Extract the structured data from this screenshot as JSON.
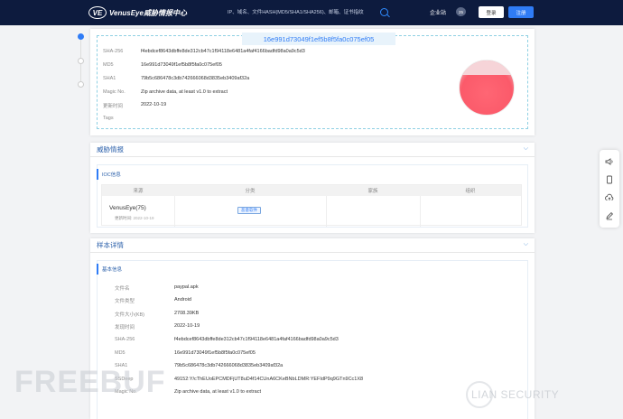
{
  "header": {
    "logo_mark": "VE",
    "logo_text": "VenusEye威胁情报中心",
    "search_placeholder": "IP、域名、文件HASH(MD5/SHA1/SHA256)、邮箱、证书指纹",
    "enterprise_label": "企业站",
    "enterprise_badge": "25",
    "login_label": "登录",
    "register_label": "注册"
  },
  "summary": {
    "title": "16e991d73049f1ef5b8f5fa0c075ef05",
    "rows": [
      {
        "key": "SHA-256",
        "value": "f4ebdcef8643dbffe8de312cb47c1f94118e6481a4faf4166badfd98a0a9c5d3"
      },
      {
        "key": "MD5",
        "value": "16e991d73049f1ef5b8f5fa0c075ef05"
      },
      {
        "key": "SHA1",
        "value": "79b5c686478c3db742666068d3835eb3409af32a"
      },
      {
        "key": "Magic No.",
        "value": "Zip archive data, at least v1.0 to extract"
      },
      {
        "key": "更新时间",
        "value": "2022-10-19"
      },
      {
        "key": "Tags",
        "value": ""
      }
    ],
    "colors": {
      "pie": "#fb5a6a"
    }
  },
  "threat_section": {
    "title": "威胁情报",
    "ioc_title": "IOC信息",
    "columns": [
      "来源",
      "分类",
      "家族",
      "组织"
    ],
    "row": {
      "source": "VenusEye(75)",
      "updated_label": "更新时间",
      "updated_value": "2022-10-19",
      "category": "恶意软件",
      "family": "",
      "organization": ""
    }
  },
  "sample_section": {
    "title": "样本详情",
    "basic_title": "基本信息",
    "rows": [
      {
        "key": "文件名",
        "value": "paypal.apk"
      },
      {
        "key": "文件类型",
        "value": "Android"
      },
      {
        "key": "文件大小(KB)",
        "value": "2708.39KB"
      },
      {
        "key": "发现时间",
        "value": "2022-10-19"
      },
      {
        "key": "SHA-256",
        "value": "f4ebdcef8643dbffe8de312cb47c1f94118e6481a4faf4166badfd98a0a9c5d3"
      },
      {
        "key": "MD5",
        "value": "16e991d73049f1ef5b8f5fa0c075ef05"
      },
      {
        "key": "SHA1",
        "value": "79b5c686478c3db742666068d3835eb3409af32a"
      },
      {
        "key": "SSDeep",
        "value": "49152:Y/cThEUoEPCMDFjUT8uD4f14CUnA6CKeBNbLDMR:YEFIdP9q9GTn9Cc1X8"
      },
      {
        "key": "Magic No.",
        "value": "Zip archive data, at least v1.0 to extract"
      }
    ]
  },
  "floating_toolbar": {
    "icons": [
      "speaker-icon",
      "phone-icon",
      "cloud-upload-icon",
      "edit-icon"
    ]
  },
  "watermarks": {
    "left": "FREEBUF",
    "right": "LIAN SECURITY"
  }
}
